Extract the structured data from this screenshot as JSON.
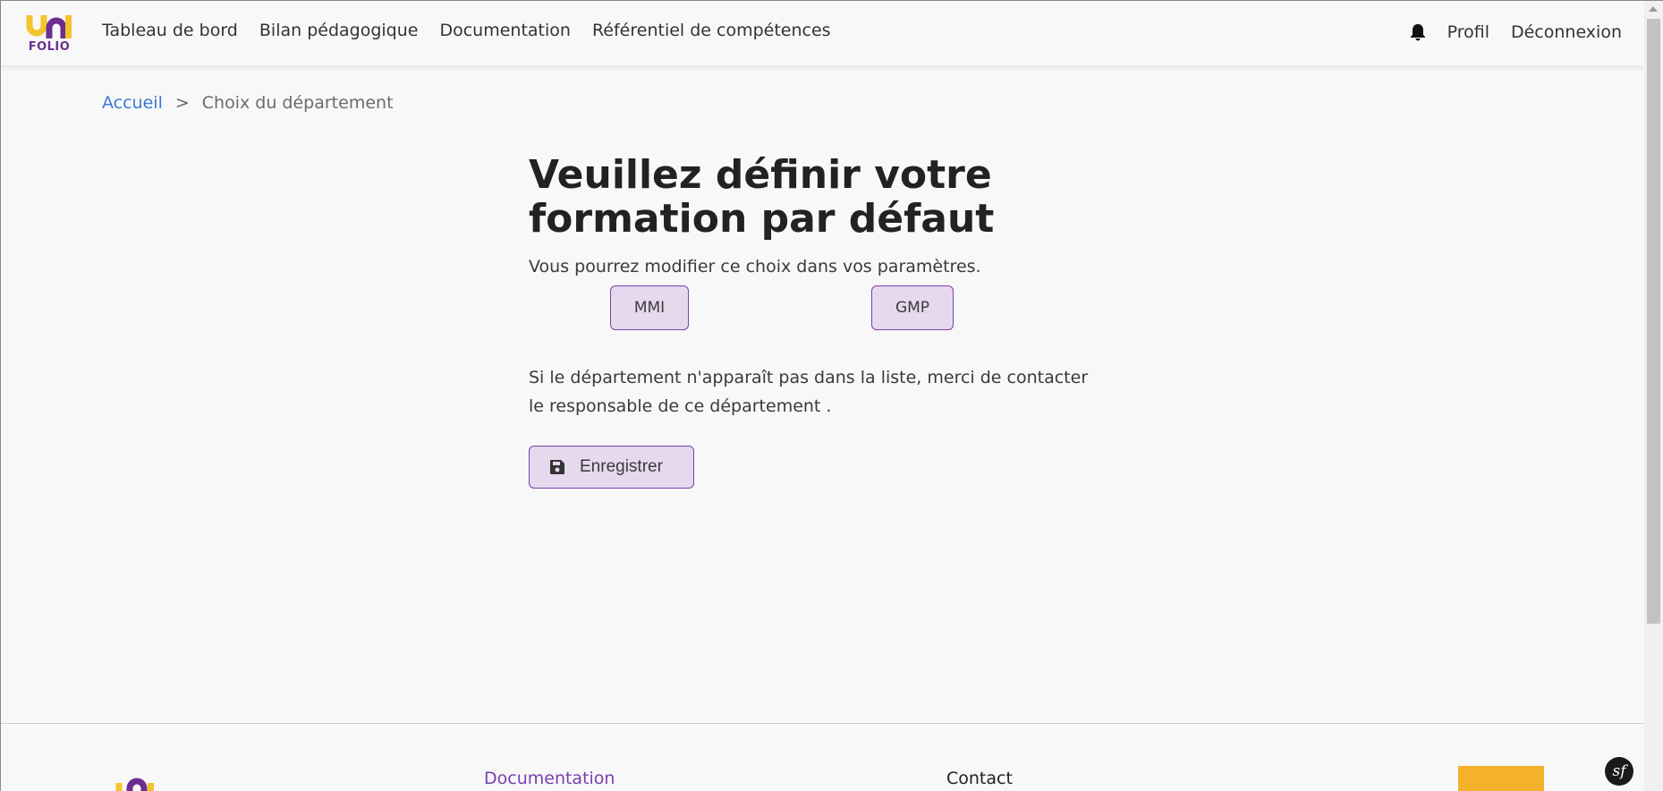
{
  "header": {
    "logo_text": "FOLIO",
    "nav": [
      "Tableau de bord",
      "Bilan pédagogique",
      "Documentation",
      "Référentiel de compétences"
    ],
    "right": {
      "profile": "Profil",
      "logout": "Déconnexion"
    }
  },
  "breadcrumb": {
    "home": "Accueil",
    "separator": ">",
    "current": "Choix du département"
  },
  "main": {
    "title_line1": "Veuillez définir votre",
    "title_line2": "formation par défaut",
    "subtitle": "Vous pourrez modifier ce choix dans vos paramètres.",
    "departments": [
      "MMI",
      "GMP"
    ],
    "note_line1": "Si le département n'apparaît pas dans la liste, merci de contacter",
    "note_line2": "le responsable de ce département .",
    "save_label": "Enregistrer"
  },
  "footer": {
    "documentation": "Documentation",
    "contact": "Contact"
  },
  "colors": {
    "accent": "#7a3fb0",
    "button_bg": "#e6d9ee",
    "link": "#3b78d6",
    "logo_yellow": "#f3c42b",
    "logo_purple": "#6b2f8f"
  },
  "icons": [
    "bell-icon",
    "save-icon",
    "symfony-icon"
  ]
}
